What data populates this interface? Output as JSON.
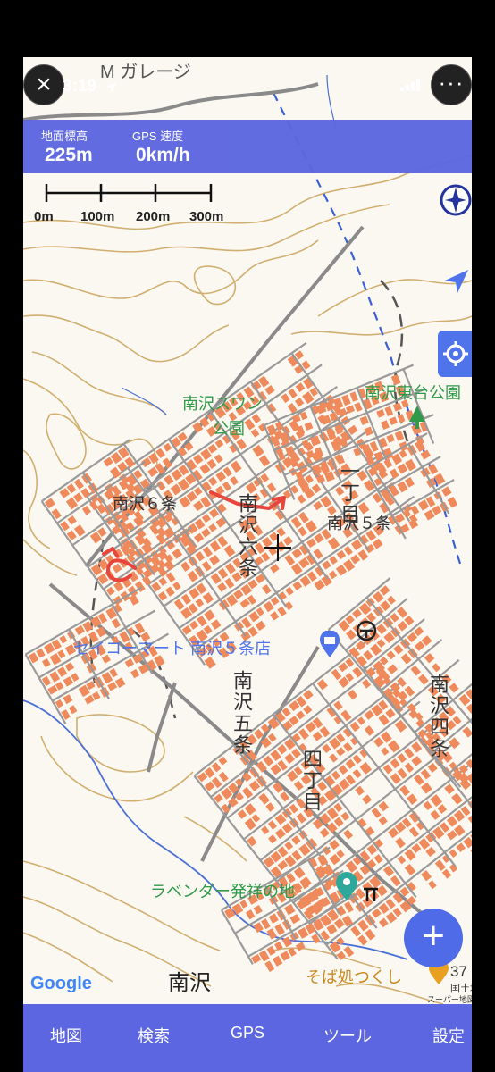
{
  "status_bar": {
    "time": "3:19"
  },
  "info": {
    "elevation_label": "地面標高",
    "elevation_value": "225m",
    "speed_label": "GPS 速度",
    "speed_value": "0km/h"
  },
  "scale_bar": {
    "ticks": [
      "0m",
      "100m",
      "200m",
      "300m"
    ]
  },
  "map_labels": {
    "garage": "M ガレージ",
    "swan_park_1": "南沢スワン",
    "swan_park_2": "公園",
    "higashidai_park": "南沢東台公園",
    "minamisawa_6jo": "南沢６条",
    "minamisawa_5jo": "南沢５条",
    "vert_1": "南沢六条",
    "vert_2": "一丁目",
    "seicomart": "セイコーマート 南沢５条店",
    "vert_3": "南沢五条",
    "vert_4": "四丁目",
    "vert_5": "南沢四条",
    "lavender": "ラベンダー発祥の地",
    "minamisawa": "南沢",
    "soba": "そば処つくし",
    "route_num": "37",
    "kokudo": "国土地",
    "super": "スーパー地図"
  },
  "attribution": {
    "google": "Google"
  },
  "tabs": [
    "地図",
    "検索",
    "GPS",
    "ツール",
    "設定"
  ],
  "colors": {
    "accent": "#5c66e0",
    "button": "#4f6be8",
    "building": "#ee8a5c",
    "road": "#8a8a8a",
    "contour": "#c9a35a"
  }
}
